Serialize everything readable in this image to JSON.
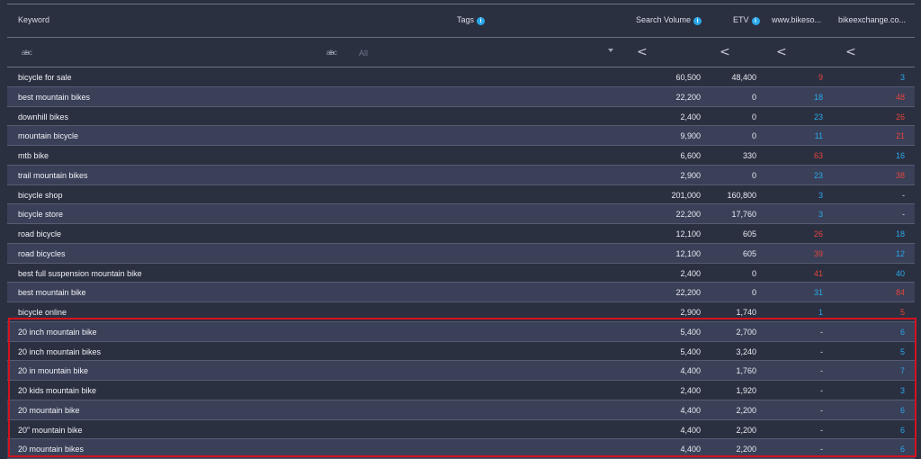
{
  "header": {
    "keyword": "Keyword",
    "tags": "Tags",
    "search_volume": "Search Volume",
    "etv": "ETV",
    "site1": "www.bikeso...",
    "site2": "bikeexchange.co..."
  },
  "filters": {
    "keyword_placeholder": "",
    "tags_value": "All",
    "sort_symbol": "<"
  },
  "rows": [
    {
      "keyword": "bicycle for sale",
      "sv": "60,500",
      "etv": "48,400",
      "c1": "9",
      "c1_color": "red",
      "c2": "3",
      "c2_color": "blue"
    },
    {
      "keyword": "best mountain bikes",
      "sv": "22,200",
      "etv": "0",
      "c1": "18",
      "c1_color": "blue",
      "c2": "48",
      "c2_color": "red"
    },
    {
      "keyword": "downhill bikes",
      "sv": "2,400",
      "etv": "0",
      "c1": "23",
      "c1_color": "blue",
      "c2": "26",
      "c2_color": "red"
    },
    {
      "keyword": "mountain bicycle",
      "sv": "9,900",
      "etv": "0",
      "c1": "11",
      "c1_color": "blue",
      "c2": "21",
      "c2_color": "red"
    },
    {
      "keyword": "mtb bike",
      "sv": "6,600",
      "etv": "330",
      "c1": "63",
      "c1_color": "red",
      "c2": "16",
      "c2_color": "blue"
    },
    {
      "keyword": "trail mountain bikes",
      "sv": "2,900",
      "etv": "0",
      "c1": "23",
      "c1_color": "blue",
      "c2": "38",
      "c2_color": "red"
    },
    {
      "keyword": "bicycle shop",
      "sv": "201,000",
      "etv": "160,800",
      "c1": "3",
      "c1_color": "blue",
      "c2": "-",
      "c2_color": "muted"
    },
    {
      "keyword": "bicycle store",
      "sv": "22,200",
      "etv": "17,760",
      "c1": "3",
      "c1_color": "blue",
      "c2": "-",
      "c2_color": "muted"
    },
    {
      "keyword": "road bicycle",
      "sv": "12,100",
      "etv": "605",
      "c1": "26",
      "c1_color": "red",
      "c2": "18",
      "c2_color": "blue"
    },
    {
      "keyword": "road bicycles",
      "sv": "12,100",
      "etv": "605",
      "c1": "39",
      "c1_color": "red",
      "c2": "12",
      "c2_color": "blue"
    },
    {
      "keyword": "best full suspension mountain bike",
      "sv": "2,400",
      "etv": "0",
      "c1": "41",
      "c1_color": "red",
      "c2": "40",
      "c2_color": "blue"
    },
    {
      "keyword": "best mountain bike",
      "sv": "22,200",
      "etv": "0",
      "c1": "31",
      "c1_color": "blue",
      "c2": "84",
      "c2_color": "red"
    },
    {
      "keyword": "bicycle online",
      "sv": "2,900",
      "etv": "1,740",
      "c1": "1",
      "c1_color": "blue",
      "c2": "5",
      "c2_color": "red"
    },
    {
      "keyword": "20 inch mountain bike",
      "sv": "5,400",
      "etv": "2,700",
      "c1": "-",
      "c1_color": "muted",
      "c2": "6",
      "c2_color": "blue"
    },
    {
      "keyword": "20 inch mountain bikes",
      "sv": "5,400",
      "etv": "3,240",
      "c1": "-",
      "c1_color": "muted",
      "c2": "5",
      "c2_color": "blue"
    },
    {
      "keyword": "20 in mountain bike",
      "sv": "4,400",
      "etv": "1,760",
      "c1": "-",
      "c1_color": "muted",
      "c2": "7",
      "c2_color": "blue"
    },
    {
      "keyword": "20 kids mountain bike",
      "sv": "2,400",
      "etv": "1,920",
      "c1": "-",
      "c1_color": "muted",
      "c2": "3",
      "c2_color": "blue"
    },
    {
      "keyword": "20 mountain bike",
      "sv": "4,400",
      "etv": "2,200",
      "c1": "-",
      "c1_color": "muted",
      "c2": "6",
      "c2_color": "blue"
    },
    {
      "keyword": "20” mountain bike",
      "sv": "4,400",
      "etv": "2,200",
      "c1": "-",
      "c1_color": "muted",
      "c2": "6",
      "c2_color": "blue"
    },
    {
      "keyword": "20 mountain bikes",
      "sv": "4,400",
      "etv": "2,200",
      "c1": "-",
      "c1_color": "muted",
      "c2": "6",
      "c2_color": "blue"
    }
  ],
  "colors": {
    "red": "#e5443a",
    "blue": "#29a8ea",
    "highlight": "#d4121f",
    "background": "#2b3041",
    "alt_row": "#3a4058"
  }
}
